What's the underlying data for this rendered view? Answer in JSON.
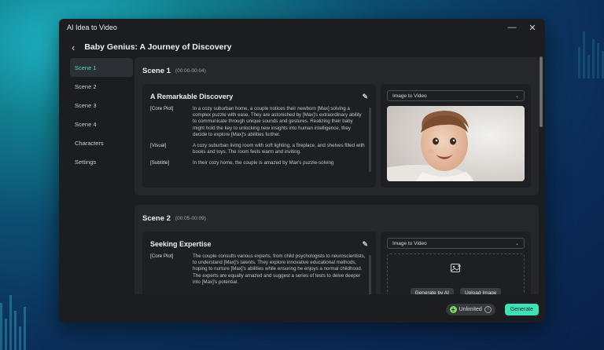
{
  "window": {
    "title": "AI Idea to Video",
    "minimize_icon": "minimize-icon",
    "close_icon": "close-icon"
  },
  "header": {
    "back_icon": "chevron-left-icon",
    "project_title": "Baby Genius: A Journey of Discovery"
  },
  "sidebar": {
    "items": [
      {
        "label": "Scene 1",
        "active": true
      },
      {
        "label": "Scene 2",
        "active": false
      },
      {
        "label": "Scene 3",
        "active": false
      },
      {
        "label": "Scene 4",
        "active": false
      },
      {
        "label": "Characters",
        "active": false
      },
      {
        "label": "Settings",
        "active": false
      }
    ]
  },
  "scenes": [
    {
      "name": "Scene 1",
      "time": "(00:00-00:04)",
      "card_title": "A Remarkable Discovery",
      "edit_icon": "pencil-icon",
      "fields": [
        {
          "label": "[Core Plot]",
          "text": "In a cozy suburban home, a couple notices their newborn [Max] solving a complex puzzle with ease. They are astonished by [Max]'s extraordinary ability to communicate through unique sounds and gestures. Realizing their baby might hold the key to unlocking new insights into human intelligence, they decide to explore [Max]'s abilities further."
        },
        {
          "label": "[Visual]",
          "text": "A cozy suburban living room with soft lighting, a fireplace, and shelves filled with books and toys. The room feels warm and inviting."
        },
        {
          "label": "[Subtitle]",
          "text": "In their cozy home, the couple is amazed by Max's puzzle-solving"
        }
      ],
      "media_mode": "Image to Video"
    },
    {
      "name": "Scene 2",
      "time": "(00:05-00:09)",
      "card_title": "Seeking Expertise",
      "edit_icon": "pencil-icon",
      "fields": [
        {
          "label": "[Core Plot]",
          "text": "The couple consults various experts, from child psychologists to neuroscientists, to understand [Max]'s talents. They explore innovative educational methods, hoping to nurture [Max]'s abilities while ensuring he enjoys a normal childhood. The experts are equally amazed and suggest a series of tests to delve deeper into [Max]'s potential."
        }
      ],
      "media_mode": "Image to Video",
      "upload_icon": "image-add-icon",
      "generate_ai_label": "Generate by AI",
      "upload_image_label": "Upload Image"
    }
  ],
  "footer": {
    "unlimited_label": "Unlimited",
    "help_icon": "question-icon",
    "generate_label": "Generate"
  },
  "colors": {
    "accent": "#3fe0b8",
    "active_text": "#4ee0c6",
    "window_bg": "#1b1d20",
    "panel_bg": "#25272b"
  }
}
